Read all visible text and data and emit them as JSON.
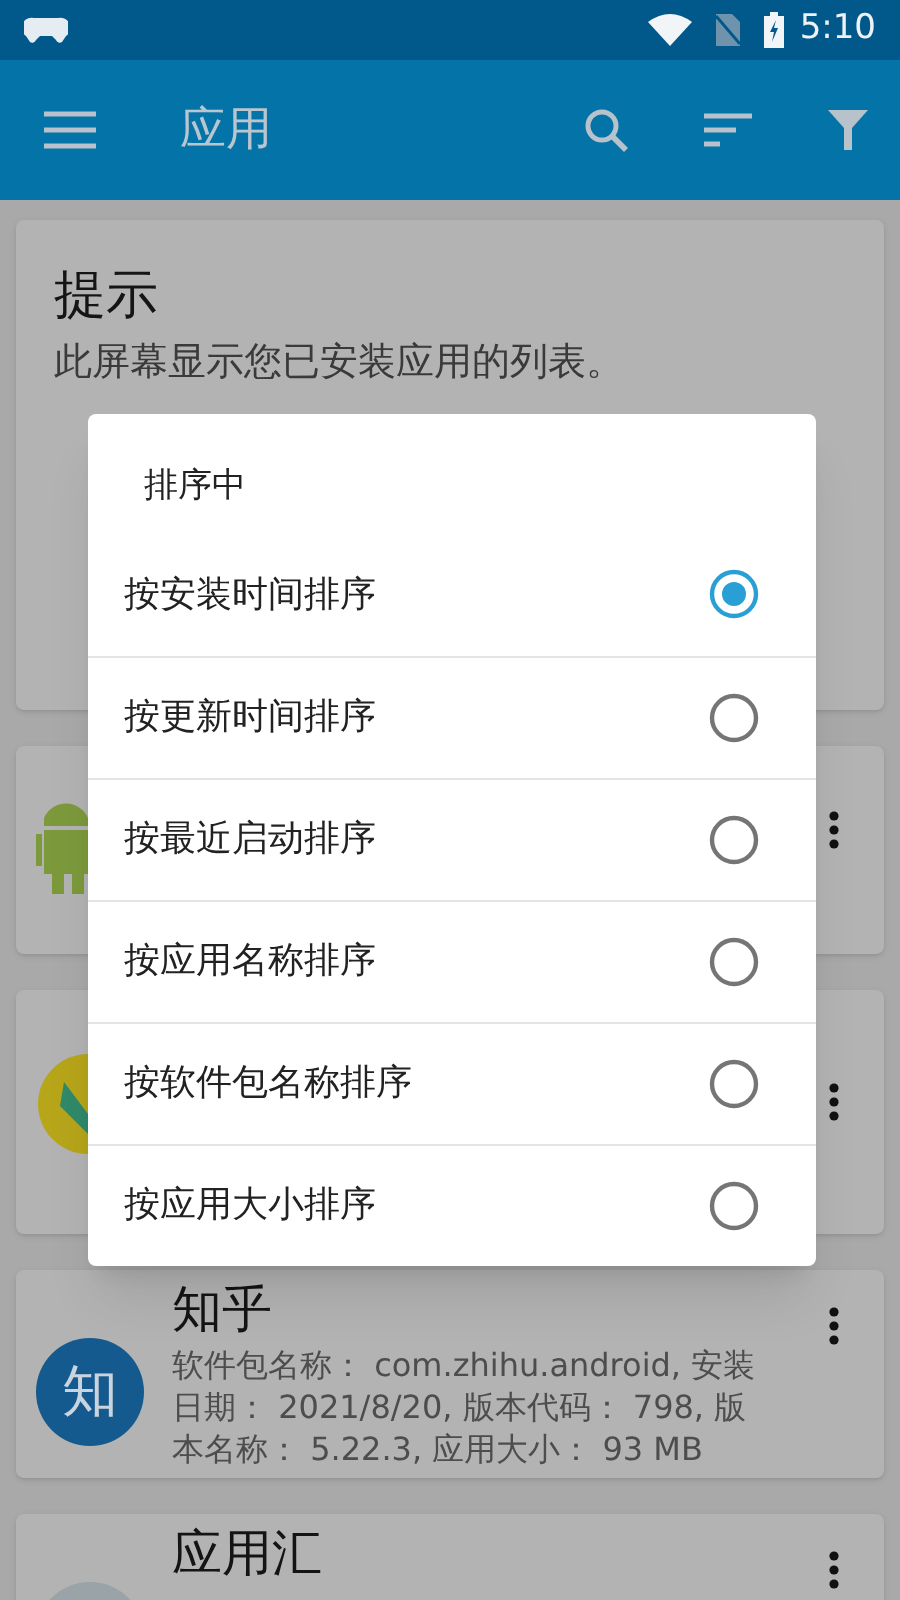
{
  "status_bar": {
    "time": "5:10"
  },
  "toolbar": {
    "title": "应用"
  },
  "hint_card": {
    "title": "提示",
    "lines": [
      "此屏幕显示您已安装应用的列表。"
    ]
  },
  "apps": [
    {
      "kind": "android"
    },
    {
      "kind": "yellow"
    },
    {
      "kind": "letter",
      "name": "知乎",
      "icon_text": "知",
      "details": "软件包名称： com.zhihu.android, 安装日期： 2021/8/20, 版本代码： 798, 版本名称： 5.22.3, 应用大小： 93 MB"
    },
    {
      "kind": "generic",
      "name": "应用汇"
    }
  ],
  "sort_dialog": {
    "title": "排序中",
    "options": [
      {
        "label": "按安装时间排序",
        "selected": true
      },
      {
        "label": "按更新时间排序",
        "selected": false
      },
      {
        "label": "按最近启动排序",
        "selected": false
      },
      {
        "label": "按应用名称排序",
        "selected": false
      },
      {
        "label": "按软件包名称排序",
        "selected": false
      },
      {
        "label": "按应用大小排序",
        "selected": false
      }
    ]
  }
}
